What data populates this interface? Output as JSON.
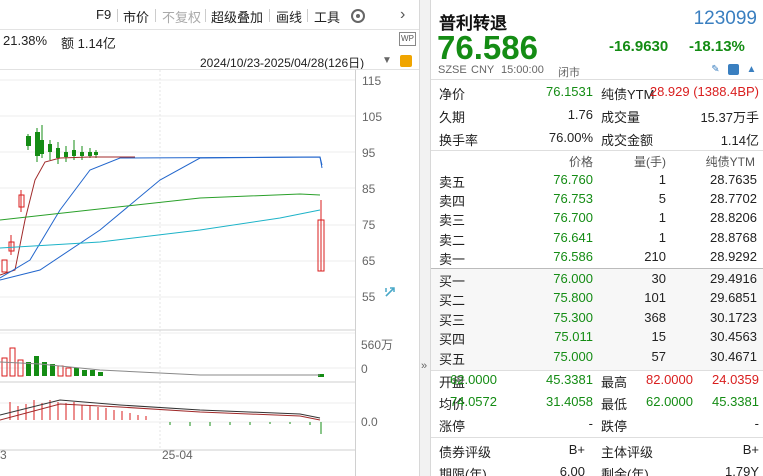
{
  "toolbar": {
    "items": [
      "F9",
      "市价",
      "不复权",
      "超级叠加",
      "画线",
      "工具"
    ],
    "gear_icon": "gear-icon",
    "next_icon": "chevron-right-icon"
  },
  "chart_header": {
    "turnover": "21.38%",
    "amount": "额 1.14亿",
    "date_range": "2024/10/23-2025/04/28(126日)",
    "badge": "WP"
  },
  "chart": {
    "price_ticks": [
      "115",
      "105",
      "95",
      "85",
      "75",
      "65",
      "55"
    ],
    "volume_ticks": [
      "560万",
      "0"
    ],
    "macd_ticks": [
      "0.0"
    ],
    "x_labels": [
      "3",
      "25-04"
    ],
    "up_color": "#d91e1e",
    "down_color": "#148c14",
    "ma_colors": [
      "#a02a2a",
      "#2266cc",
      "#2aa02a",
      "#1db3c8"
    ]
  },
  "quote": {
    "name": "普利转退",
    "code": "123099",
    "price": "76.586",
    "change": "-16.9630",
    "change_pct": "-18.13%",
    "meta": [
      "SZSE",
      "CNY",
      "15:00:00",
      "闭市"
    ],
    "rows": [
      {
        "l1": "净价",
        "v1": "76.1531",
        "l2": "纯债YTM",
        "v2": "28.929 (1388.4BP)",
        "v2c": "red"
      },
      {
        "l1": "久期",
        "v1": "1.76",
        "l2": "成交量",
        "v2": "15.37万手",
        "v2c": ""
      },
      {
        "l1": "换手率",
        "v1": "76.00%",
        "l2": "成交金额",
        "v2": "1.14亿",
        "v2c": ""
      }
    ],
    "book_header": {
      "price": "价格",
      "qty": "量(手)",
      "ytm": "纯债YTM"
    },
    "asks": [
      {
        "label": "卖五",
        "price": "76.760",
        "qty": "1",
        "ytm": "28.7635"
      },
      {
        "label": "卖四",
        "price": "76.753",
        "qty": "5",
        "ytm": "28.7702"
      },
      {
        "label": "卖三",
        "price": "76.700",
        "qty": "1",
        "ytm": "28.8206"
      },
      {
        "label": "卖二",
        "price": "76.641",
        "qty": "1",
        "ytm": "28.8768"
      },
      {
        "label": "卖一",
        "price": "76.586",
        "qty": "210",
        "ytm": "28.9292"
      }
    ],
    "bids": [
      {
        "label": "买一",
        "price": "76.000",
        "qty": "30",
        "ytm": "29.4916"
      },
      {
        "label": "买二",
        "price": "75.800",
        "qty": "101",
        "ytm": "29.6851"
      },
      {
        "label": "买三",
        "price": "75.300",
        "qty": "368",
        "ytm": "30.1723"
      },
      {
        "label": "买四",
        "price": "75.011",
        "qty": "15",
        "ytm": "30.4563"
      },
      {
        "label": "买五",
        "price": "75.000",
        "qty": "57",
        "ytm": "30.4671"
      }
    ],
    "stats": [
      {
        "l1": "开盘",
        "v1a": "62.0000",
        "v1b": "45.3381",
        "v1c": "green",
        "l2": "最高",
        "v2a": "82.0000",
        "v2b": "24.0359",
        "v2c": "red"
      },
      {
        "l1": "均价",
        "v1a": "74.0572",
        "v1b": "31.4058",
        "v1c": "green",
        "l2": "最低",
        "v2a": "62.0000",
        "v2b": "45.3381",
        "v2c": "green"
      },
      {
        "l1": "涨停",
        "v1a": "",
        "v1b": "-",
        "v1c": "",
        "l2": "跌停",
        "v2a": "",
        "v2b": "-",
        "v2c": ""
      }
    ],
    "rating": [
      {
        "l1": "债券评级",
        "v1": "B+",
        "l2": "主体评级",
        "v2": "B+"
      },
      {
        "l1": "期限(年)",
        "v1": "6.00",
        "l2": "剩余(年)",
        "v2": "1.79Y"
      }
    ]
  }
}
